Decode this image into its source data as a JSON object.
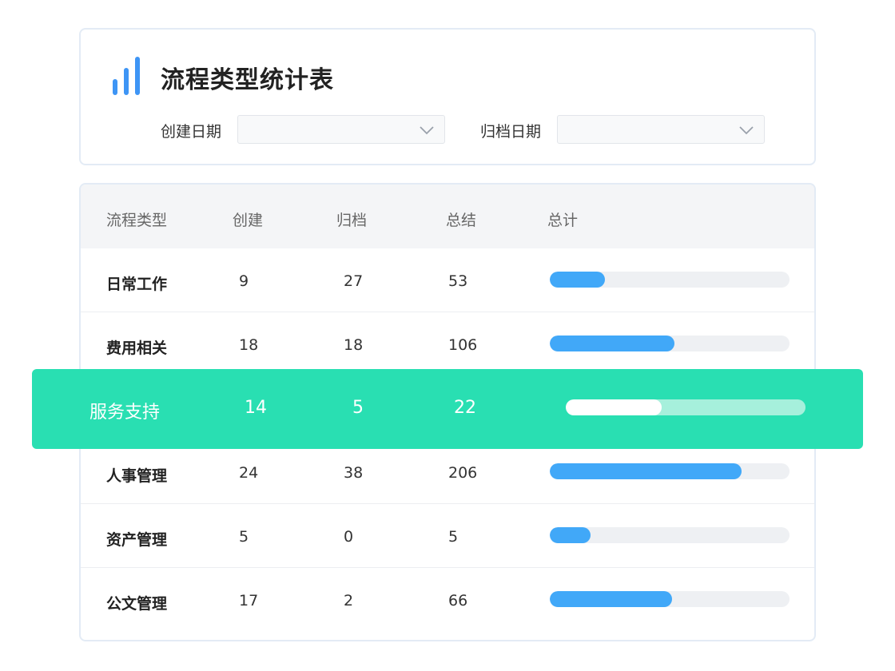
{
  "header": {
    "title": "流程类型统计表",
    "icon": "bar-chart-icon"
  },
  "filters": [
    {
      "label": "创建日期",
      "value": "",
      "icon": "chevron-down-icon"
    },
    {
      "label": "归档日期",
      "value": "",
      "icon": "chevron-down-icon"
    }
  ],
  "table": {
    "columns": [
      "流程类型",
      "创建",
      "归档",
      "总结",
      "总计"
    ],
    "rows": [
      {
        "type": "日常工作",
        "created": "9",
        "archived": "27",
        "summary": "53",
        "total_ratio": 0.23
      },
      {
        "type": "费用相关",
        "created": "18",
        "archived": "18",
        "summary": "106",
        "total_ratio": 0.52
      },
      {
        "type": "服务支持",
        "created": "14",
        "archived": "5",
        "summary": "22",
        "total_ratio": 0.4,
        "highlighted": true
      },
      {
        "type": "人事管理",
        "created": "24",
        "archived": "38",
        "summary": "206",
        "total_ratio": 0.8
      },
      {
        "type": "资产管理",
        "created": "5",
        "archived": "0",
        "summary": "5",
        "total_ratio": 0.17
      },
      {
        "type": "公文管理",
        "created": "17",
        "archived": "2",
        "summary": "66",
        "total_ratio": 0.51
      }
    ]
  },
  "colors": {
    "accent": "#3e95f5",
    "bar": "#41a8f8",
    "highlight": "#29dfb2"
  }
}
